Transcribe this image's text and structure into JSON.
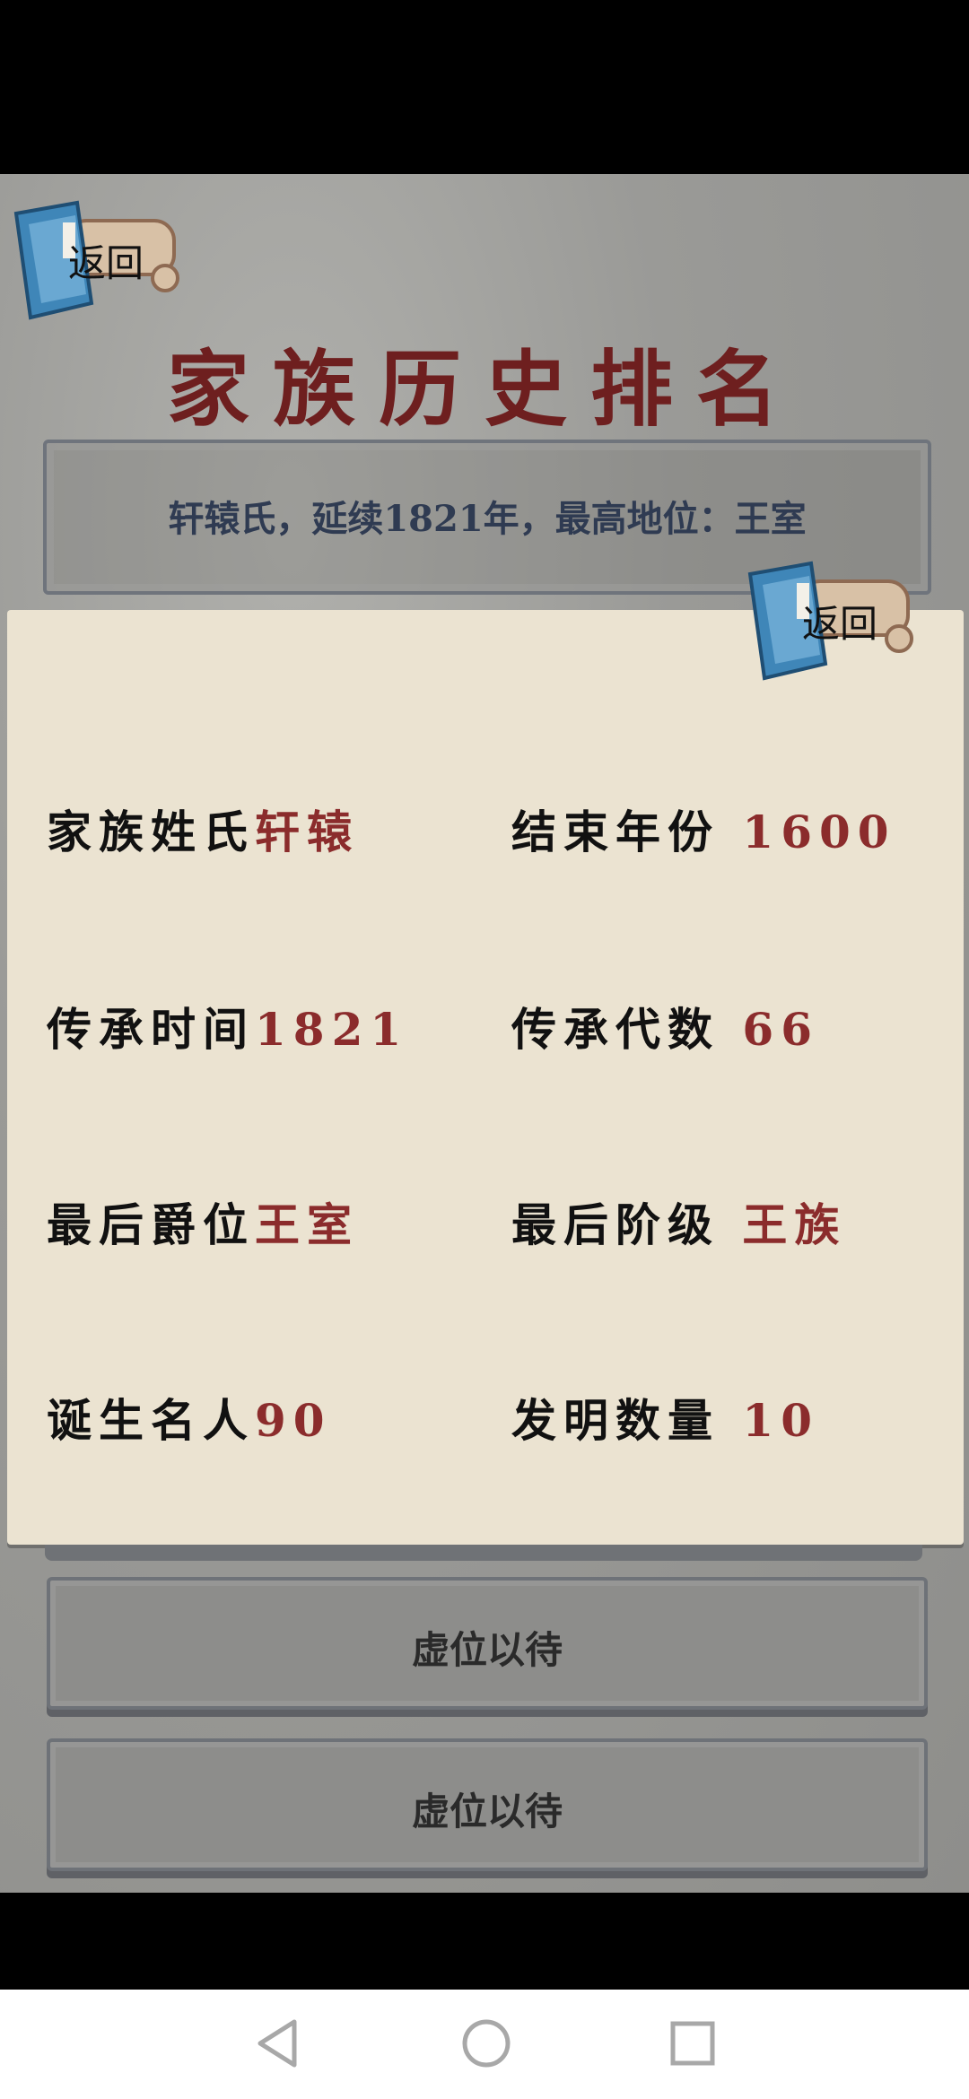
{
  "header": {
    "back_label": "返回",
    "title": "家族历史排名"
  },
  "banner": {
    "summary": "轩辕氏，延续1821年，最高地位：王室"
  },
  "detail": {
    "back_label": "返回",
    "stats": [
      {
        "label": "家族姓氏",
        "value": "轩辕"
      },
      {
        "label": "结束年份",
        "value": "1600"
      },
      {
        "label": "传承时间",
        "value": "1821"
      },
      {
        "label": "传承代数",
        "value": "66"
      },
      {
        "label": "最后爵位",
        "value": "王室"
      },
      {
        "label": "最后阶级",
        "value": "王族"
      },
      {
        "label": "诞生名人",
        "value": "90"
      },
      {
        "label": "发明数量",
        "value": "10"
      }
    ]
  },
  "slots": [
    {
      "label": "虚位以待"
    },
    {
      "label": "虚位以待"
    }
  ],
  "colors": {
    "title": "#6e1f1f",
    "value": "#8b2c2c",
    "banner_text": "#2f3b52",
    "paper": "#ebe3d1"
  },
  "nav": {
    "icons": [
      "back-triangle-icon",
      "home-circle-icon",
      "recents-square-icon"
    ]
  }
}
